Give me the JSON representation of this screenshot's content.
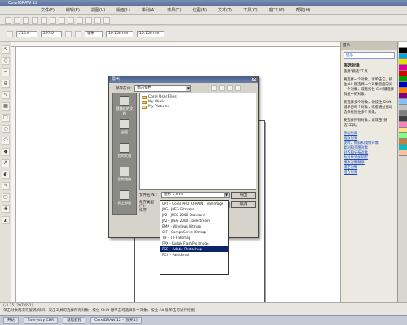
{
  "app": {
    "title": "CorelDRAW 12"
  },
  "menu": [
    "文件(F)",
    "编辑(E)",
    "视图(V)",
    "版面(L)",
    "排列(A)",
    "效果(C)",
    "位图(B)",
    "文本(T)",
    "工具(O)",
    "窗口(W)",
    "帮助(H)"
  ],
  "property_bar": {
    "size_w": "210.0",
    "size_h": "297.0",
    "units": "毫米",
    "nudge_1": "10.158 mm",
    "nudge_2": "10.158 mm"
  },
  "dialog": {
    "title": "导出",
    "look_in_label": "保存在(I):",
    "look_in_value": "我的文档",
    "places": [
      "我最近的文档",
      "桌面",
      "我的文档",
      "我的电脑",
      "网上邻居"
    ],
    "files": [
      "Corel User Files",
      "My Music",
      "My Pictures"
    ],
    "filename_label": "文件名(N):",
    "filename_value": "图形 1.cmx",
    "filetype_label": "保存类型(T):",
    "filetype_value": "CMX - Corel Presentation Exchange",
    "sort_label": "排序:",
    "export_button": "导出",
    "cancel_button": "取消",
    "filetypes": [
      "CPT - Corel PHOTO-PAINT 7/8 Image",
      "JPG - JPEG Bitmaps",
      "JP2 - JPEG 2000 Standard",
      "JP2 - JPEG 2000 Codestream",
      "BMP - Windows Bitmap",
      "GIF - CompuServe Bitmap",
      "TIF - TIFF Bitmap",
      "FPX - Kodak FlashPix Image",
      "PSD - Adobe Photoshop",
      "PCX - PaintBrush"
    ],
    "selected_filetype_index": 8
  },
  "docker": {
    "header": "提示",
    "search_value": "提示",
    "title": "挑选对象",
    "paragraphs": [
      "使用\"挑选\"工具",
      "要选择一个对象，请单击它。按住 Alt 键选择一个对象后面的另一个对象，或者按住 Ctrl 键选择群组中的对象。",
      "要选择多个对象，请按住 Shift 键单击每个对象，或者通过拖动选择框围住多个对象。",
      "要选择所有对象，请双击\"挑选\"工具。"
    ],
    "links": [
      "移动对象",
      "缩放对象",
      "旋转、倾斜和镜像对象",
      "复制和克隆对象",
      "对齐和分布对象",
      "为对象添加阴影",
      "更改对象顺序",
      "锁定对象",
      "组合对象"
    ]
  },
  "palette_colors": [
    "#ffffff",
    "#000000",
    "#00a0e0",
    "#e0e000",
    "#e000a0",
    "#e00000",
    "#00a000",
    "#0000c0",
    "#ff8000",
    "#800080",
    "#80c0ff",
    "#c0c0c0",
    "#808080",
    "#404040",
    "#ff80c0",
    "#ffe080",
    "#80ff80",
    "#c08040",
    "#00c0c0",
    "#ffc0a0"
  ],
  "status": {
    "line1": "(-2.35, 297.651)",
    "line2": "单击对象两次可旋转/倾斜；双击工具可选择所有对象；按住 Shift 键单击可选择多个对象；按住 Alt 键单击可进行挖掘"
  },
  "taskbar": [
    "开始",
    "Everyday CDR",
    "基础教程",
    "CorelDRAW 12 - [图形1]"
  ]
}
